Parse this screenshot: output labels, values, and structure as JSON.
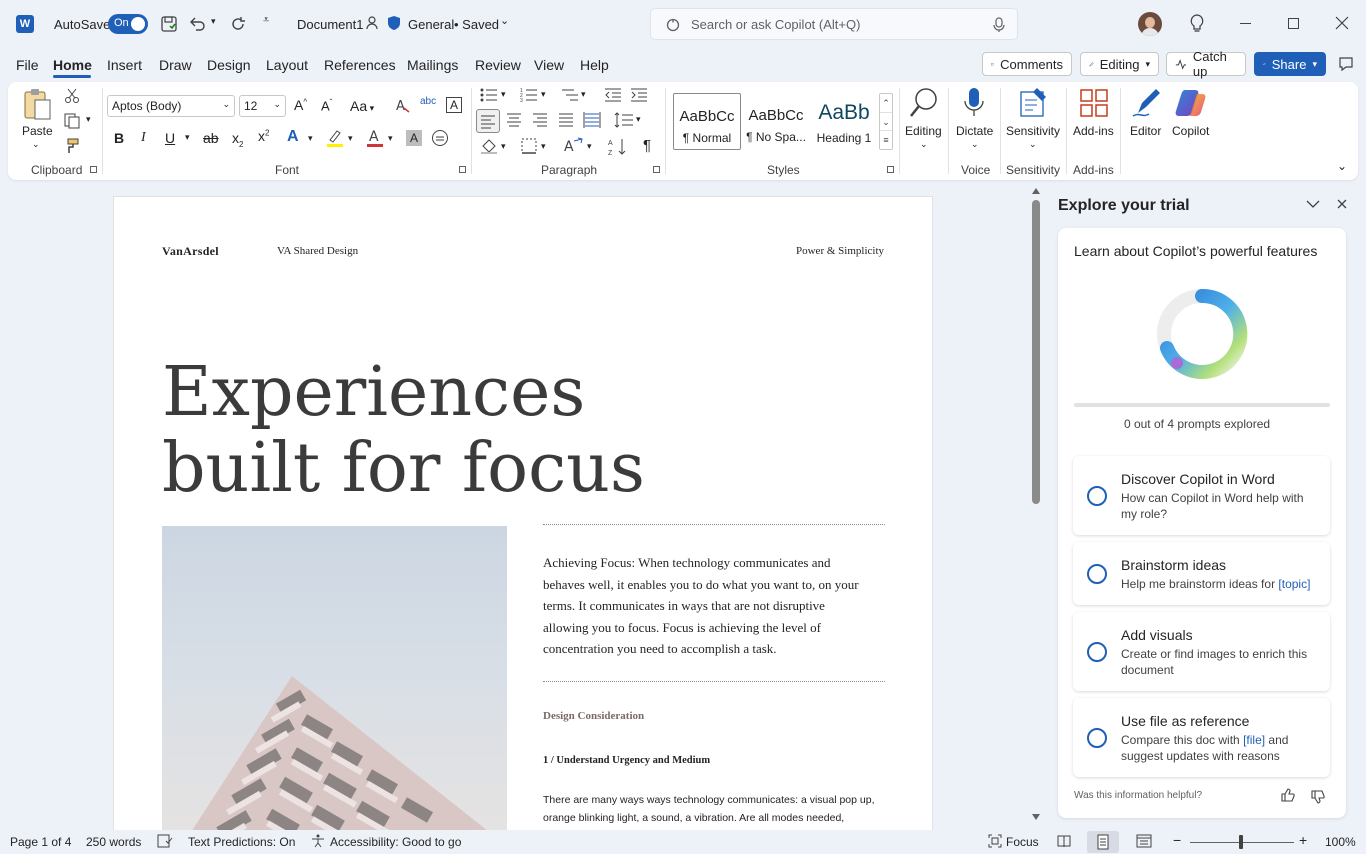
{
  "titlebar": {
    "autosave_label": "AutoSave",
    "autosave_state": "On",
    "doc_name": "Document1",
    "sensitivity_label": "General",
    "save_state": "• Saved"
  },
  "search": {
    "placeholder": "Search or ask Copilot (Alt+Q)"
  },
  "menu": {
    "tabs": [
      "File",
      "Home",
      "Insert",
      "Draw",
      "Design",
      "Layout",
      "References",
      "Mailings",
      "Review",
      "View",
      "Help"
    ],
    "active": "Home",
    "comments_label": "Comments",
    "editing_label": "Editing",
    "catchup_label": "Catch up",
    "share_label": "Share"
  },
  "ribbon": {
    "clipboard": {
      "paste": "Paste",
      "group": "Clipboard"
    },
    "font": {
      "family": "Aptos (Body)",
      "size": "12",
      "group": "Font"
    },
    "paragraph": {
      "group": "Paragraph"
    },
    "styles": {
      "group": "Styles",
      "items": [
        {
          "sample": "AaBbCc",
          "name": "¶ Normal"
        },
        {
          "sample": "AaBbCc",
          "name": "¶ No Spa..."
        },
        {
          "sample": "AaBb",
          "name": "Heading 1"
        }
      ]
    },
    "editing": {
      "label": "Editing"
    },
    "voice": {
      "label": "Dictate",
      "group": "Voice"
    },
    "sensitivity": {
      "label": "Sensitivity",
      "group": "Sensitivity"
    },
    "addins": {
      "label": "Add-ins",
      "group": "Add-ins"
    },
    "editor": {
      "label": "Editor"
    },
    "copilot": {
      "label": "Copilot"
    }
  },
  "document": {
    "logo": "VanArsdel",
    "header_center": "VA Shared Design",
    "header_right": "Power & Simplicity",
    "heading_line1": "Experiences",
    "heading_line2": "built for focus",
    "para1": "Achieving Focus: When technology communicates and behaves well, it enables you to do what you want to, on your terms. It communicates in ways that are not disruptive allowing you to focus. Focus is achieving the level of concentration you need to accomplish a task.",
    "section_title": "Design Consideration",
    "subhead": "1 / Understand Urgency and Medium",
    "para2": "There are many ways ways technology communicates: a visual pop up, orange blinking light, a sound, a vibration. Are all modes needed,"
  },
  "pane": {
    "title": "Explore your trial",
    "card_title": "Learn about Copilot’s powerful features",
    "progress_text": "0 out of 4 prompts explored",
    "progress_fraction": 0,
    "prompts": [
      {
        "title": "Discover Copilot in Word",
        "desc": "How can Copilot in Word help with my role?"
      },
      {
        "title": "Brainstorm ideas",
        "desc": "Help me brainstorm ideas for",
        "highlight": "[topic]"
      },
      {
        "title": "Add visuals",
        "desc": "Create or find images to enrich this document"
      },
      {
        "title": "Use file as reference",
        "desc_pre": "Compare this doc with",
        "highlight": "[file]",
        "desc_post": "and suggest updates with reasons"
      }
    ],
    "feedback": "Was this information helpful?"
  },
  "status": {
    "page": "Page 1 of 4",
    "words": "250 words",
    "predictions": "Text Predictions: On",
    "accessibility": "Accessibility: Good to go",
    "focus": "Focus",
    "zoom": "100%"
  },
  "colors": {
    "accent": "#1f5fb8",
    "background": "#edf1f8"
  }
}
